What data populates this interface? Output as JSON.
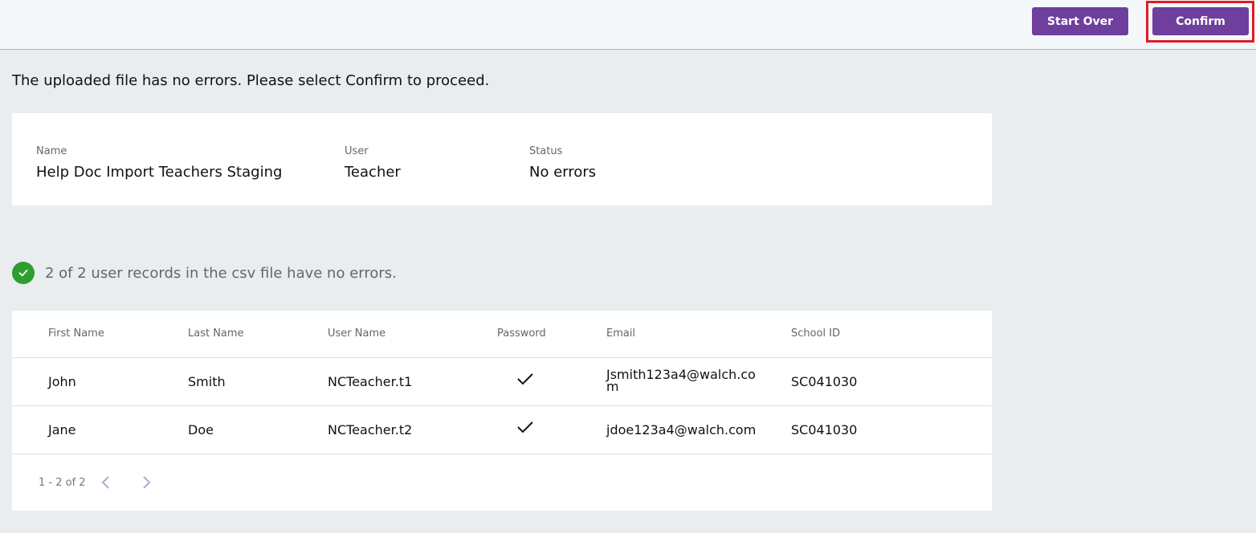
{
  "toolbar": {
    "start_over_label": "Start Over",
    "confirm_label": "Confirm"
  },
  "message": "The uploaded file has no errors. Please select Confirm to proceed.",
  "summary": {
    "name_label": "Name",
    "name_value": "Help Doc Import Teachers Staging",
    "user_label": "User",
    "user_value": "Teacher",
    "status_label": "Status",
    "status_value": "No errors"
  },
  "validation": {
    "icon": "check-circle-icon",
    "text": "2 of 2 user records in the csv file have no errors."
  },
  "table": {
    "headers": [
      "First Name",
      "Last Name",
      "User Name",
      "Password",
      "Email",
      "School ID"
    ],
    "rows": [
      {
        "first": "John",
        "last": "Smith",
        "username": "NCTeacher.t1",
        "password": "check-icon",
        "email": "Jsmith123a4@walch.com",
        "school_id": "SC041030"
      },
      {
        "first": "Jane",
        "last": "Doe",
        "username": "NCTeacher.t2",
        "password": "check-icon",
        "email": "jdoe123a4@walch.com",
        "school_id": "SC041030"
      }
    ]
  },
  "pagination": {
    "range": "1 - 2 of 2",
    "prev_icon": "chevron-left-icon",
    "next_icon": "chevron-right-icon"
  },
  "colors": {
    "accent": "#6e3f9c",
    "highlight": "#e01b24",
    "success": "#2e9e2e"
  }
}
